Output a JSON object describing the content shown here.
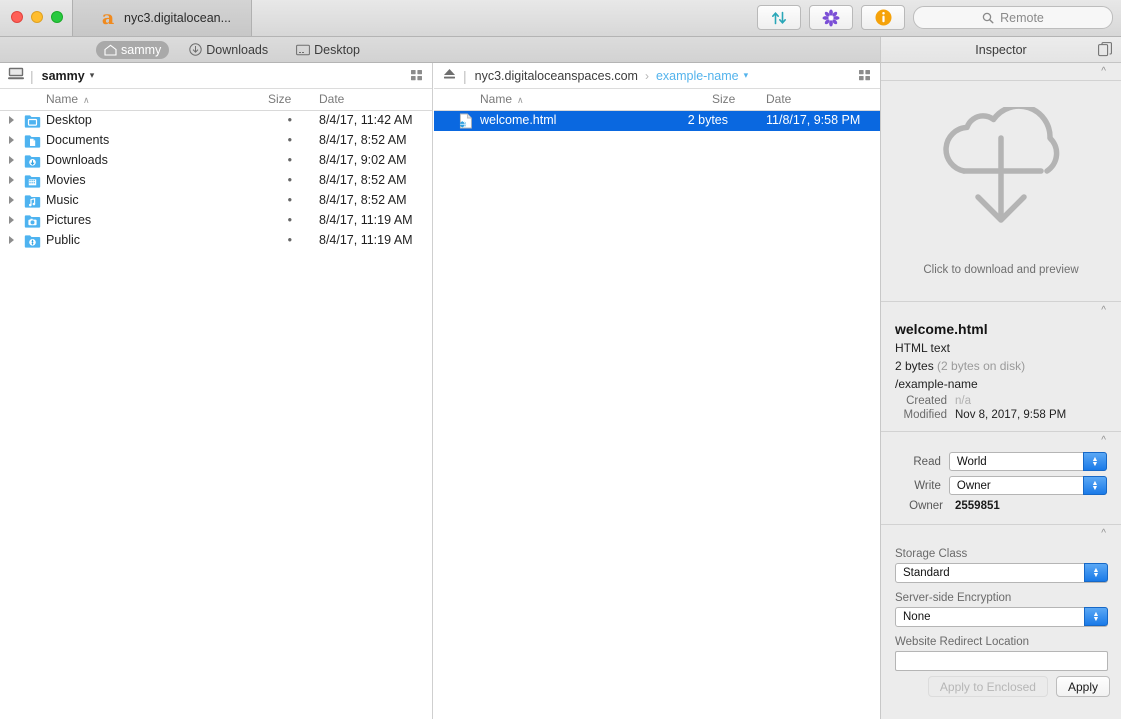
{
  "window": {
    "tab_title": "nyc3.digitalocean...",
    "tab_icon": "s3-a-icon"
  },
  "toolbar": {
    "transfer_icon": "transfer-arrows-icon",
    "refresh_icon": "pinwheel-icon",
    "info_icon": "info-icon",
    "search_placeholder": "Remote",
    "search_icon": "search-icon"
  },
  "bookmarks": [
    {
      "label": "sammy",
      "icon": "home-icon",
      "active": true
    },
    {
      "label": "Downloads",
      "icon": "download-circle-icon",
      "active": false
    },
    {
      "label": "Desktop",
      "icon": "desktop-window-icon",
      "active": false
    }
  ],
  "left_pane": {
    "location_icon": "computer-icon",
    "location": "sammy",
    "chevron": "⌄",
    "grid_icon": "grid-view-icon",
    "columns": [
      "Name",
      "Size",
      "Date"
    ],
    "sort_caret": "∧",
    "rows": [
      {
        "name": "Desktop",
        "icon": "folder-desktop-icon",
        "size": "•",
        "date": "8/4/17, 11:42 AM"
      },
      {
        "name": "Documents",
        "icon": "folder-documents-icon",
        "size": "•",
        "date": "8/4/17, 8:52 AM"
      },
      {
        "name": "Downloads",
        "icon": "folder-downloads-icon",
        "size": "•",
        "date": "8/4/17, 9:02 AM"
      },
      {
        "name": "Movies",
        "icon": "folder-movies-icon",
        "size": "•",
        "date": "8/4/17, 8:52 AM"
      },
      {
        "name": "Music",
        "icon": "folder-music-icon",
        "size": "•",
        "date": "8/4/17, 8:52 AM"
      },
      {
        "name": "Pictures",
        "icon": "folder-pictures-icon",
        "size": "•",
        "date": "8/4/17, 11:19 AM"
      },
      {
        "name": "Public",
        "icon": "folder-public-icon",
        "size": "•",
        "date": "8/4/17, 11:19 AM"
      }
    ]
  },
  "right_pane": {
    "eject_icon": "eject-icon",
    "host": "nyc3.digitaloceanspaces.com",
    "separator": "›",
    "bucket": "example-name",
    "chevron": "⌄",
    "grid_icon": "grid-view-icon",
    "columns": [
      "Name",
      "Size",
      "Date"
    ],
    "sort_caret": "∧",
    "rows": [
      {
        "name": "welcome.html",
        "icon": "html-file-icon",
        "size": "2 bytes",
        "date": "11/8/17, 9:58 PM",
        "selected": true
      }
    ]
  },
  "inspector": {
    "title": "Inspector",
    "copy_icon": "duplicate-window-icon",
    "collapse_icon": "chevron-up-icon",
    "preview": {
      "icon": "cloud-download-icon",
      "caption": "Click to download and preview"
    },
    "file": {
      "name": "welcome.html",
      "kind": "HTML text",
      "size": "2 bytes",
      "size_on_disk": "(2 bytes on disk)",
      "path": "/example-name",
      "created_label": "Created",
      "created_value": "n/a",
      "modified_label": "Modified",
      "modified_value": "Nov 8, 2017, 9:58 PM"
    },
    "permissions": {
      "read_label": "Read",
      "read_value": "World",
      "write_label": "Write",
      "write_value": "Owner",
      "owner_label": "Owner",
      "owner_value": "2559851"
    },
    "storage": {
      "storage_class_label": "Storage Class",
      "storage_class_value": "Standard",
      "encryption_label": "Server-side Encryption",
      "encryption_value": "None",
      "redirect_label": "Website Redirect Location",
      "redirect_value": ""
    },
    "buttons": {
      "apply_enclosed": "Apply to Enclosed",
      "apply": "Apply"
    }
  },
  "colors": {
    "selection_blue": "#0a68e0",
    "link_blue": "#53b3ec",
    "accent_orange": "#f08a1e",
    "folder_blue": "#4eb3f0"
  }
}
